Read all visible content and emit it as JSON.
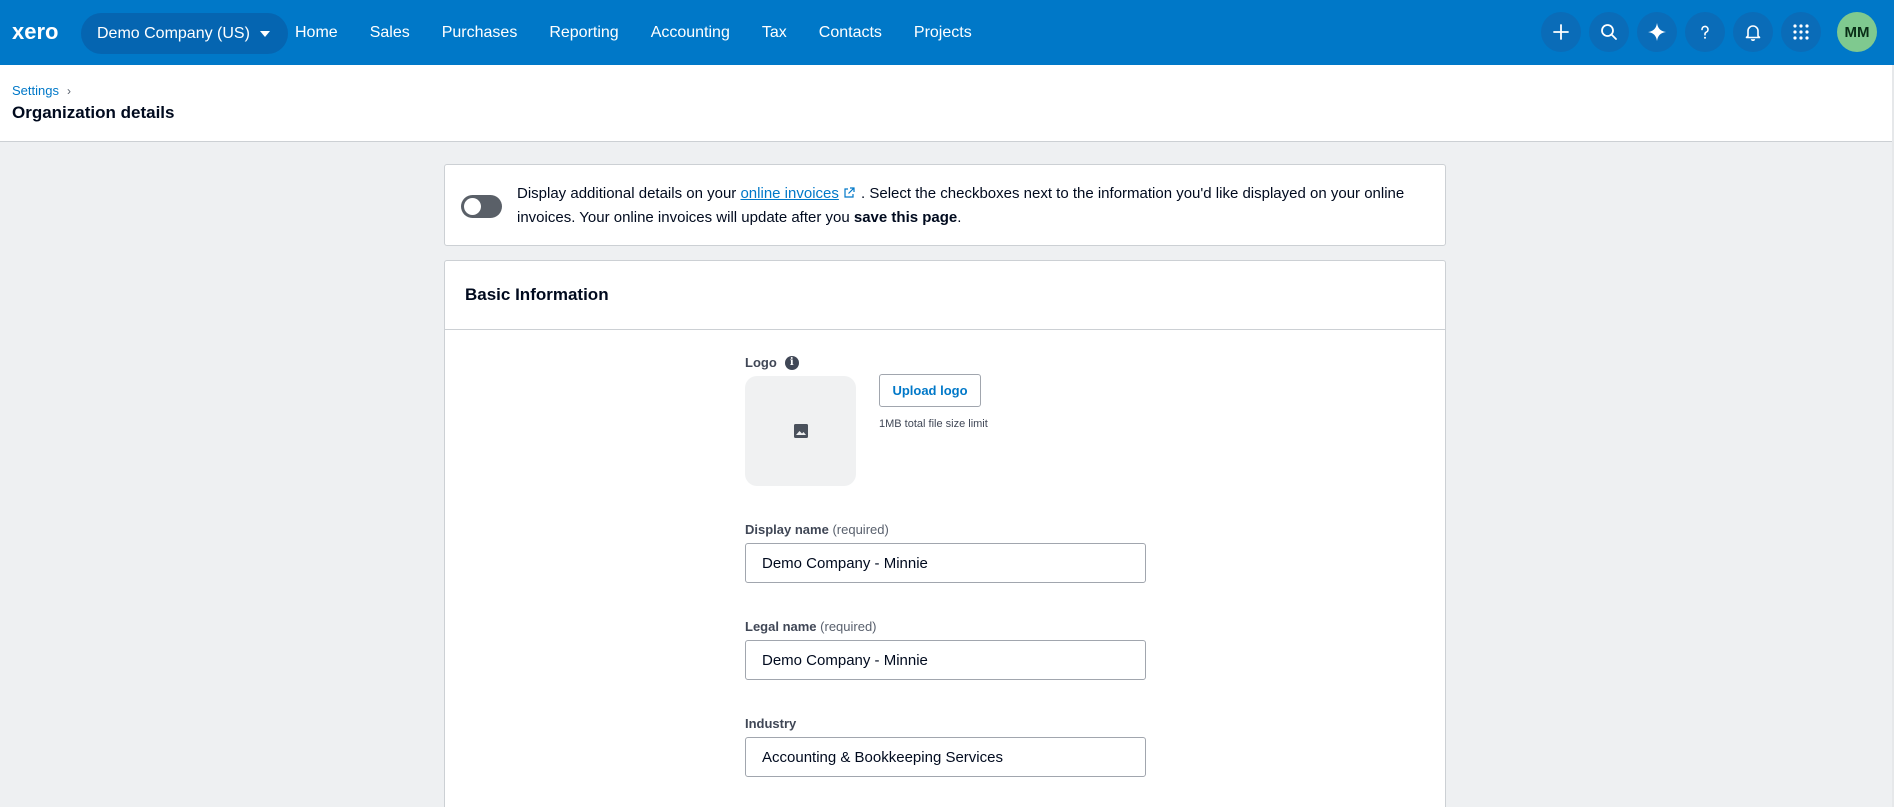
{
  "nav": {
    "brand": "xero",
    "org_name": "Demo Company (US)",
    "items": [
      "Home",
      "Sales",
      "Purchases",
      "Reporting",
      "Accounting",
      "Tax",
      "Contacts",
      "Projects"
    ],
    "icons": [
      "plus-icon",
      "search-icon",
      "sparkle-icon",
      "help-icon",
      "bell-icon",
      "apps-grid-icon"
    ],
    "avatar_initials": "MM",
    "colors": {
      "bar": "#0078c8",
      "avatar": "#7fc98f"
    }
  },
  "header": {
    "breadcrumb": "Settings",
    "title": "Organization details"
  },
  "banner": {
    "toggle_on": false,
    "text_before_link": "Display additional details on your ",
    "link_text": "online invoices",
    "text_after_link": " . Select the checkboxes next to the information you'd like displayed on your online invoices. Your online invoices will update after you ",
    "bold_text": "save this page",
    "text_end": "."
  },
  "basic_info": {
    "title": "Basic Information",
    "logo_label": "Logo",
    "upload_button": "Upload logo",
    "file_limit": "1MB total file size limit",
    "display_name": {
      "label": "Display name",
      "required": "(required)",
      "value": "Demo Company - Minnie"
    },
    "legal_name": {
      "label": "Legal name",
      "required": "(required)",
      "value": "Demo Company - Minnie"
    },
    "industry": {
      "label": "Industry",
      "value": "Accounting & Bookkeeping Services"
    }
  }
}
